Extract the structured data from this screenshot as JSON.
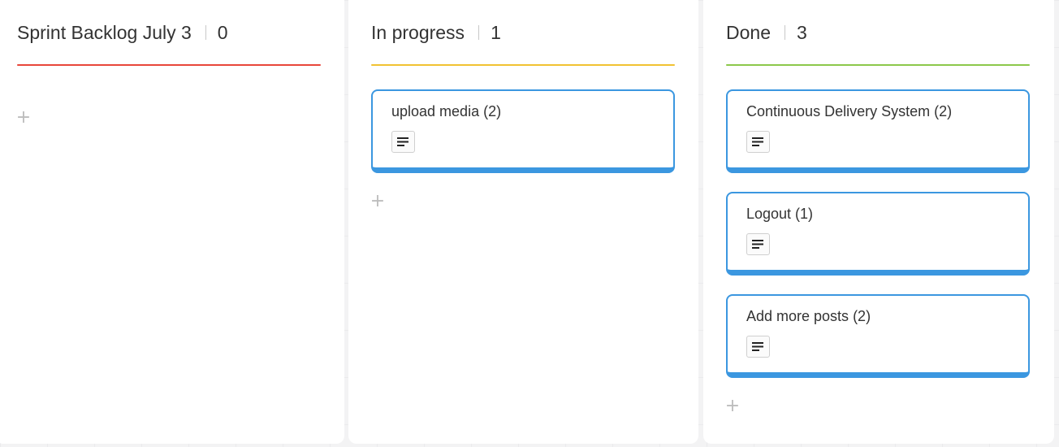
{
  "columns": [
    {
      "title": "Sprint Backlog July 3",
      "count": "0",
      "accent_color": "#e8463a",
      "cards": [],
      "add_icon": "+"
    },
    {
      "title": "In progress",
      "count": "1",
      "accent_color": "#f1c232",
      "cards": [
        {
          "title": "upload media (2)",
          "icon": "description-icon"
        }
      ],
      "add_icon": "+"
    },
    {
      "title": "Done",
      "count": "3",
      "accent_color": "#8cc84b",
      "cards": [
        {
          "title": "Continuous Delivery System (2)",
          "icon": "description-icon"
        },
        {
          "title": "Logout (1)",
          "icon": "description-icon"
        },
        {
          "title": "Add more posts (2)",
          "icon": "description-icon"
        }
      ],
      "add_icon": "+"
    }
  ],
  "card_border_color": "#3b97e0"
}
